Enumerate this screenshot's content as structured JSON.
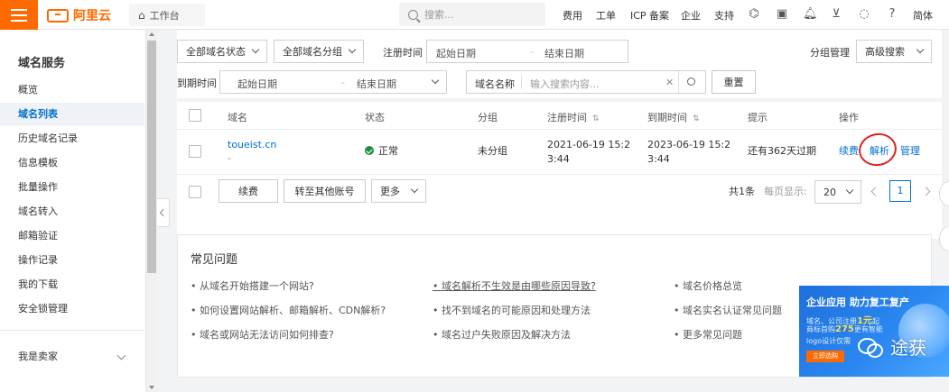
{
  "topbar": {
    "brand": "阿里云",
    "workbench": "工作台",
    "search_placeholder": "搜索...",
    "nav": [
      "费用",
      "工单",
      "ICP 备案",
      "企业",
      "支持"
    ],
    "lang": "简体",
    "icons": [
      "code-icon",
      "terminal-icon",
      "bell-icon",
      "cart-icon",
      "bulb-icon",
      "help-icon"
    ]
  },
  "sidebar": {
    "title": "域名服务",
    "items": [
      "概览",
      "域名列表",
      "历史域名记录",
      "信息模板",
      "批量操作",
      "域名转入",
      "邮箱验证",
      "操作记录",
      "我的下载",
      "安全锁管理"
    ],
    "active_index": 1,
    "seller": "我是卖家"
  },
  "filters": {
    "status_select": "全部域名状态",
    "group_select": "全部域名分组",
    "reg_time_label": "注册时间",
    "start_date": "起始日期",
    "end_date": "结束日期",
    "group_manage": "分组管理",
    "advanced_search": "高级搜索",
    "expire_time_label": "到期时间",
    "domain_name_label": "域名名称",
    "search_placeholder": "输入搜索内容...",
    "reset": "重置"
  },
  "table": {
    "headers": [
      "域名",
      "状态",
      "分组",
      "注册时间",
      "到期时间",
      "提示",
      "操作"
    ],
    "row": {
      "domain": "toueist.cn",
      "domain_sub": "-",
      "status": "正常",
      "group": "未分组",
      "reg_time_1": "2021-06-19 15:2",
      "reg_time_2": "3:44",
      "exp_time_1": "2023-06-19 15:2",
      "exp_time_2": "3:44",
      "hint": "还有362天过期",
      "actions": [
        "续费",
        "解析",
        "管理"
      ]
    }
  },
  "bulk": {
    "renew": "续费",
    "transfer": "转至其他账号",
    "more": "更多",
    "total": "共1条",
    "per_page_label": "每页显示:",
    "per_page": "20",
    "page": "1"
  },
  "faq": {
    "title": "常见问题",
    "col1": [
      "• 从域名开始搭建一个网站?",
      "• 如何设置网站解析、邮箱解析、CDN解析?",
      "• 域名或网站无法访问如何排查?"
    ],
    "col2": [
      "• 域名解析不生效是由哪些原因导致?",
      "• 找不到域名的可能原因和处理方法",
      "• 域名过户失败原因及解决方法"
    ],
    "col3": [
      "• 域名价格总览",
      "• 域名实名认证常见问题",
      "• 更多常见问题"
    ]
  },
  "ad": {
    "title": "企业应用 助力复工复产",
    "line1_a": "域名、公司注册",
    "line1_b": "1元",
    "line1_c": "起",
    "line2_a": "商标首购",
    "line2_b": "275",
    "line2_c": "更有智能",
    "line3": "logo设计仅需",
    "button": "立即选购"
  },
  "watermark": "途获"
}
